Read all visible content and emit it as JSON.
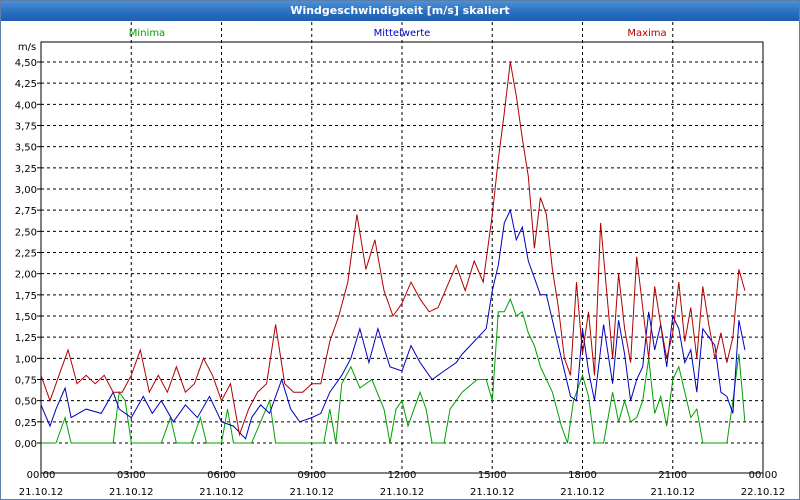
{
  "window": {
    "title": "Windgeschwindigkeit [m/s] skaliert"
  },
  "colors": {
    "minima": "#00a000",
    "mittelwerte": "#0000c0",
    "maxima": "#b00000",
    "grid": "#000000",
    "background": "#ffffff",
    "titlebar": "#2a6fc0"
  },
  "chart_data": {
    "type": "line",
    "title": "Windgeschwindigkeit [m/s] skaliert",
    "ylabel": "m/s",
    "xlabel": "",
    "ylim": [
      0,
      4.5
    ],
    "xlim": [
      0,
      24
    ],
    "grid": true,
    "legend_position": "top",
    "y_ticks": [
      "0,00",
      "0,25",
      "0,50",
      "0,75",
      "1,00",
      "1,25",
      "1,50",
      "1,75",
      "2,00",
      "2,25",
      "2,50",
      "2,75",
      "3,00",
      "3,25",
      "3,50",
      "3,75",
      "4,00",
      "4,25",
      "4,50"
    ],
    "x_ticks": [
      {
        "time": "00:00",
        "date": "21.10.12"
      },
      {
        "time": "03:00",
        "date": "21.10.12"
      },
      {
        "time": "06:00",
        "date": "21.10.12"
      },
      {
        "time": "09:00",
        "date": "21.10.12"
      },
      {
        "time": "12:00",
        "date": "21.10.12"
      },
      {
        "time": "15:00",
        "date": "21.10.12"
      },
      {
        "time": "18:00",
        "date": "21.10.12"
      },
      {
        "time": "21:00",
        "date": "21.10.12"
      },
      {
        "time": "00:00",
        "date": "22.10.12"
      }
    ],
    "x_unit": "hours since 21.10.12 00:00",
    "series": [
      {
        "name": "Minima",
        "color": "#00a000",
        "points": [
          [
            0,
            0
          ],
          [
            0.5,
            0
          ],
          [
            0.8,
            0.3
          ],
          [
            1,
            0
          ],
          [
            2,
            0
          ],
          [
            2.4,
            0
          ],
          [
            2.6,
            0.6
          ],
          [
            2.8,
            0.5
          ],
          [
            3,
            0
          ],
          [
            4,
            0
          ],
          [
            4.3,
            0.3
          ],
          [
            4.5,
            0
          ],
          [
            5,
            0
          ],
          [
            5.3,
            0.3
          ],
          [
            5.5,
            0
          ],
          [
            6,
            0
          ],
          [
            6.2,
            0.4
          ],
          [
            6.4,
            0
          ],
          [
            7,
            0
          ],
          [
            7.6,
            0.5
          ],
          [
            7.8,
            0
          ],
          [
            8.5,
            0
          ],
          [
            9,
            0
          ],
          [
            9.4,
            0
          ],
          [
            9.6,
            0.4
          ],
          [
            9.8,
            0
          ],
          [
            10,
            0.7
          ],
          [
            10.3,
            0.9
          ],
          [
            10.6,
            0.65
          ],
          [
            11,
            0.75
          ],
          [
            11.4,
            0.4
          ],
          [
            11.6,
            0
          ],
          [
            11.8,
            0.4
          ],
          [
            12,
            0.5
          ],
          [
            12.2,
            0.2
          ],
          [
            12.4,
            0.4
          ],
          [
            12.6,
            0.6
          ],
          [
            12.8,
            0.4
          ],
          [
            13,
            0
          ],
          [
            13.4,
            0
          ],
          [
            13.6,
            0.4
          ],
          [
            14,
            0.6
          ],
          [
            14.5,
            0.75
          ],
          [
            14.8,
            0.75
          ],
          [
            15,
            0.5
          ],
          [
            15.2,
            1.55
          ],
          [
            15.4,
            1.55
          ],
          [
            15.6,
            1.7
          ],
          [
            15.8,
            1.5
          ],
          [
            16,
            1.55
          ],
          [
            16.2,
            1.3
          ],
          [
            16.4,
            1.15
          ],
          [
            16.6,
            0.9
          ],
          [
            17,
            0.6
          ],
          [
            17.3,
            0.2
          ],
          [
            17.5,
            0
          ],
          [
            17.7,
            0.5
          ],
          [
            18,
            0.8
          ],
          [
            18.2,
            0.55
          ],
          [
            18.4,
            0
          ],
          [
            18.7,
            0
          ],
          [
            19,
            0.6
          ],
          [
            19.2,
            0.25
          ],
          [
            19.4,
            0.5
          ],
          [
            19.6,
            0.25
          ],
          [
            19.8,
            0.3
          ],
          [
            20,
            0.5
          ],
          [
            20.2,
            1.0
          ],
          [
            20.4,
            0.35
          ],
          [
            20.6,
            0.55
          ],
          [
            20.8,
            0.2
          ],
          [
            21,
            0.75
          ],
          [
            21.2,
            0.9
          ],
          [
            21.4,
            0.6
          ],
          [
            21.6,
            0.3
          ],
          [
            21.8,
            0.4
          ],
          [
            22,
            0
          ],
          [
            22.4,
            0
          ],
          [
            22.8,
            0
          ],
          [
            23,
            0.5
          ],
          [
            23.2,
            1.05
          ],
          [
            23.4,
            0.25
          ]
        ]
      },
      {
        "name": "Mittelwerte",
        "color": "#0000c0",
        "points": [
          [
            0,
            0.45
          ],
          [
            0.3,
            0.2
          ],
          [
            0.5,
            0.4
          ],
          [
            0.8,
            0.65
          ],
          [
            1,
            0.3
          ],
          [
            1.5,
            0.4
          ],
          [
            2,
            0.35
          ],
          [
            2.4,
            0.6
          ],
          [
            2.6,
            0.4
          ],
          [
            3,
            0.3
          ],
          [
            3.4,
            0.55
          ],
          [
            3.7,
            0.35
          ],
          [
            4,
            0.5
          ],
          [
            4.4,
            0.25
          ],
          [
            4.8,
            0.45
          ],
          [
            5.2,
            0.3
          ],
          [
            5.6,
            0.55
          ],
          [
            6,
            0.25
          ],
          [
            6.4,
            0.2
          ],
          [
            6.8,
            0.05
          ],
          [
            7,
            0.3
          ],
          [
            7.3,
            0.45
          ],
          [
            7.6,
            0.35
          ],
          [
            8,
            0.75
          ],
          [
            8.3,
            0.4
          ],
          [
            8.6,
            0.25
          ],
          [
            9,
            0.3
          ],
          [
            9.3,
            0.35
          ],
          [
            9.6,
            0.6
          ],
          [
            10,
            0.8
          ],
          [
            10.3,
            1.0
          ],
          [
            10.6,
            1.35
          ],
          [
            10.9,
            0.95
          ],
          [
            11.2,
            1.35
          ],
          [
            11.6,
            0.9
          ],
          [
            12,
            0.85
          ],
          [
            12.3,
            1.15
          ],
          [
            12.6,
            0.95
          ],
          [
            13,
            0.75
          ],
          [
            13.4,
            0.85
          ],
          [
            13.8,
            0.95
          ],
          [
            14,
            1.05
          ],
          [
            14.4,
            1.2
          ],
          [
            14.8,
            1.35
          ],
          [
            15,
            1.8
          ],
          [
            15.2,
            2.1
          ],
          [
            15.4,
            2.6
          ],
          [
            15.6,
            2.75
          ],
          [
            15.8,
            2.4
          ],
          [
            16,
            2.55
          ],
          [
            16.2,
            2.15
          ],
          [
            16.4,
            1.95
          ],
          [
            16.6,
            1.75
          ],
          [
            16.8,
            1.75
          ],
          [
            17,
            1.45
          ],
          [
            17.3,
            1.0
          ],
          [
            17.6,
            0.55
          ],
          [
            17.8,
            0.5
          ],
          [
            18,
            1.35
          ],
          [
            18.2,
            0.85
          ],
          [
            18.4,
            0.5
          ],
          [
            18.7,
            1.4
          ],
          [
            19,
            0.7
          ],
          [
            19.2,
            1.45
          ],
          [
            19.4,
            1.05
          ],
          [
            19.6,
            0.5
          ],
          [
            19.8,
            0.75
          ],
          [
            20,
            0.9
          ],
          [
            20.2,
            1.55
          ],
          [
            20.4,
            1.1
          ],
          [
            20.6,
            1.4
          ],
          [
            20.8,
            0.9
          ],
          [
            21,
            1.5
          ],
          [
            21.2,
            1.35
          ],
          [
            21.4,
            0.95
          ],
          [
            21.6,
            1.1
          ],
          [
            21.8,
            0.6
          ],
          [
            22,
            1.35
          ],
          [
            22.4,
            1.15
          ],
          [
            22.6,
            0.6
          ],
          [
            22.8,
            0.55
          ],
          [
            23,
            0.35
          ],
          [
            23.2,
            1.45
          ],
          [
            23.4,
            1.1
          ]
        ]
      },
      {
        "name": "Maxima",
        "color": "#b00000",
        "points": [
          [
            0,
            0.8
          ],
          [
            0.3,
            0.5
          ],
          [
            0.6,
            0.8
          ],
          [
            0.9,
            1.1
          ],
          [
            1.2,
            0.7
          ],
          [
            1.5,
            0.8
          ],
          [
            1.8,
            0.7
          ],
          [
            2.1,
            0.8
          ],
          [
            2.4,
            0.6
          ],
          [
            2.7,
            0.6
          ],
          [
            3,
            0.8
          ],
          [
            3.3,
            1.1
          ],
          [
            3.6,
            0.6
          ],
          [
            3.9,
            0.8
          ],
          [
            4.2,
            0.6
          ],
          [
            4.5,
            0.9
          ],
          [
            4.8,
            0.6
          ],
          [
            5.1,
            0.7
          ],
          [
            5.4,
            1.0
          ],
          [
            5.7,
            0.8
          ],
          [
            6,
            0.5
          ],
          [
            6.3,
            0.7
          ],
          [
            6.6,
            0.1
          ],
          [
            6.9,
            0.4
          ],
          [
            7.2,
            0.6
          ],
          [
            7.5,
            0.7
          ],
          [
            7.8,
            1.4
          ],
          [
            8.1,
            0.7
          ],
          [
            8.4,
            0.6
          ],
          [
            8.7,
            0.6
          ],
          [
            9,
            0.7
          ],
          [
            9.3,
            0.7
          ],
          [
            9.6,
            1.2
          ],
          [
            9.9,
            1.5
          ],
          [
            10.2,
            1.9
          ],
          [
            10.5,
            2.7
          ],
          [
            10.8,
            2.05
          ],
          [
            11.1,
            2.4
          ],
          [
            11.4,
            1.8
          ],
          [
            11.7,
            1.5
          ],
          [
            12,
            1.65
          ],
          [
            12.3,
            1.9
          ],
          [
            12.6,
            1.7
          ],
          [
            12.9,
            1.55
          ],
          [
            13.2,
            1.6
          ],
          [
            13.5,
            1.85
          ],
          [
            13.8,
            2.1
          ],
          [
            14.1,
            1.8
          ],
          [
            14.4,
            2.15
          ],
          [
            14.7,
            1.9
          ],
          [
            15,
            2.7
          ],
          [
            15.2,
            3.35
          ],
          [
            15.4,
            3.9
          ],
          [
            15.6,
            4.5
          ],
          [
            15.8,
            4.1
          ],
          [
            16,
            3.6
          ],
          [
            16.2,
            3.15
          ],
          [
            16.4,
            2.3
          ],
          [
            16.6,
            2.9
          ],
          [
            16.8,
            2.7
          ],
          [
            17,
            2.05
          ],
          [
            17.2,
            1.6
          ],
          [
            17.4,
            1.0
          ],
          [
            17.6,
            0.8
          ],
          [
            17.8,
            1.9
          ],
          [
            18,
            1.05
          ],
          [
            18.2,
            1.55
          ],
          [
            18.4,
            0.8
          ],
          [
            18.6,
            2.6
          ],
          [
            18.8,
            1.8
          ],
          [
            19,
            1.0
          ],
          [
            19.2,
            2.0
          ],
          [
            19.4,
            1.35
          ],
          [
            19.6,
            0.95
          ],
          [
            19.8,
            2.2
          ],
          [
            20,
            1.6
          ],
          [
            20.2,
            1.0
          ],
          [
            20.4,
            1.85
          ],
          [
            20.6,
            1.4
          ],
          [
            20.8,
            1.0
          ],
          [
            21,
            1.3
          ],
          [
            21.2,
            1.9
          ],
          [
            21.4,
            1.2
          ],
          [
            21.6,
            1.6
          ],
          [
            21.8,
            1.0
          ],
          [
            22,
            1.85
          ],
          [
            22.2,
            1.4
          ],
          [
            22.4,
            1.0
          ],
          [
            22.6,
            1.3
          ],
          [
            22.8,
            0.95
          ],
          [
            23,
            1.25
          ],
          [
            23.2,
            2.05
          ],
          [
            23.4,
            1.8
          ]
        ]
      }
    ]
  }
}
